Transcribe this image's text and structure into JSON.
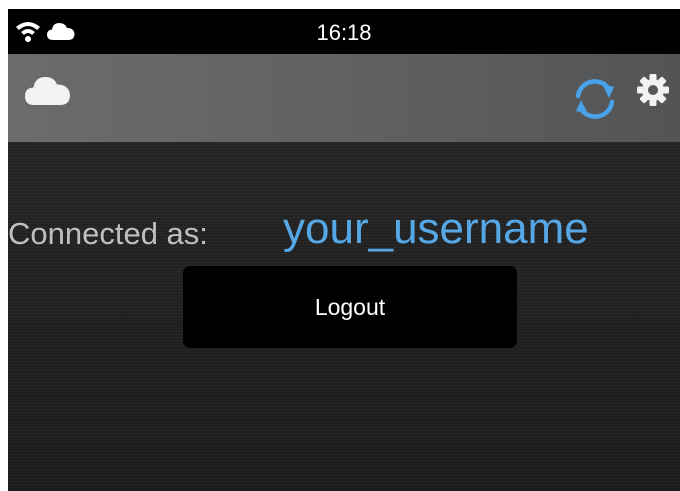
{
  "status_bar": {
    "time": "16:18",
    "icons": [
      "wifi-icon",
      "cloud-icon"
    ]
  },
  "toolbar": {
    "cloud_icon": "cloud-icon",
    "sync_icon": "sync-icon",
    "settings_icon": "gear-icon"
  },
  "main": {
    "connected_label": "Connected as:",
    "username": "your_username",
    "logout_label": "Logout"
  },
  "colors": {
    "accent": "#56a7e6",
    "status_bar_bg": "#000000",
    "toolbar_bg": "#5f6163",
    "content_bg": "#1c1c1c",
    "button_bg": "#000000"
  }
}
